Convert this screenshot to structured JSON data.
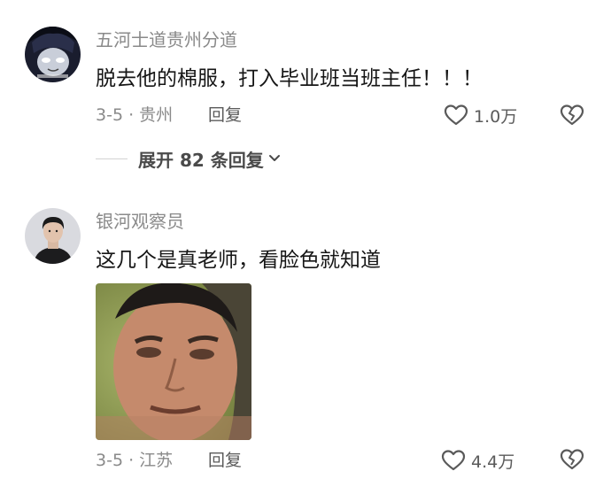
{
  "comments": [
    {
      "username": "五河士道贵州分道",
      "content": "脱去他的棉服，打入毕业班当班主任！！！",
      "date_location": "3-5 · 贵州",
      "reply_label": "回复",
      "likes": "1.0万",
      "expand_replies": "展开 82 条回复"
    },
    {
      "username": "银河观察员",
      "content": "这几个是真老师，看脸色就知道",
      "date_location": "3-5 · 江苏",
      "reply_label": "回复",
      "likes": "4.4万"
    }
  ],
  "colors": {
    "meta_text": "#8a8a8a",
    "primary_text": "#161616",
    "icon": "#5a5a5a"
  },
  "icons": [
    "heart-outline-icon",
    "broken-heart-icon",
    "chevron-down-icon"
  ]
}
